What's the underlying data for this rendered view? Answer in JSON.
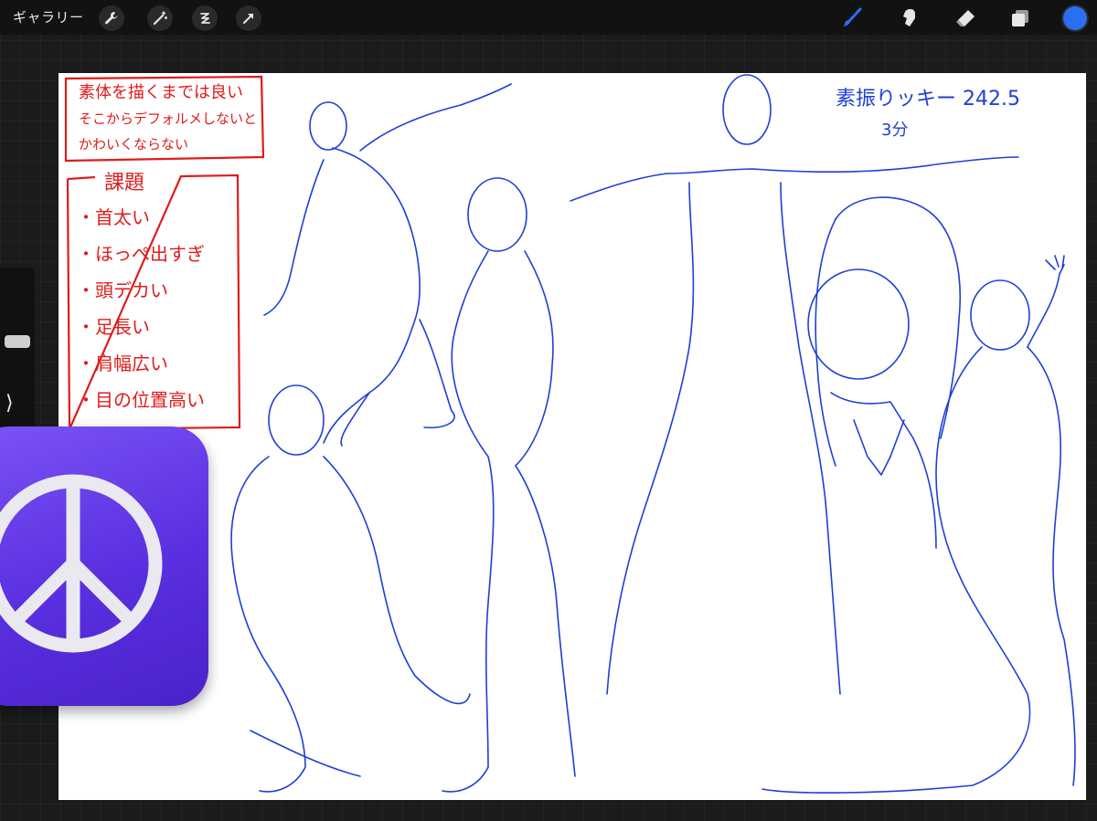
{
  "topbar": {
    "gallery_label": "ギャラリー",
    "left_tools": [
      "wrench-icon",
      "magic-wand-icon",
      "selection-icon",
      "transform-arrow-icon"
    ],
    "right_tools": [
      "brush-icon",
      "smudge-icon",
      "eraser-icon",
      "layers-icon"
    ],
    "active_color": "#2a6ef2"
  },
  "canvas": {
    "note_box_1": [
      "素体を描くまでは良い",
      "そこからデフォルメしないと",
      "かわいくならない"
    ],
    "task_title": "課題",
    "task_items": [
      "・首太い",
      "・ほっぺ出すぎ",
      "・頭デカい",
      "・足長い",
      "・肩幅広い",
      "・目の位置高い"
    ],
    "blue_note_line1": "素振りッキー 242.5",
    "blue_note_line2": "3分",
    "ink_red": "#e01b1b",
    "ink_blue": "#1f3fd6"
  },
  "overlay": {
    "icon": "peace-sign-icon",
    "gradient_top": "#7b53f5",
    "gradient_bottom": "#4a22c9"
  }
}
